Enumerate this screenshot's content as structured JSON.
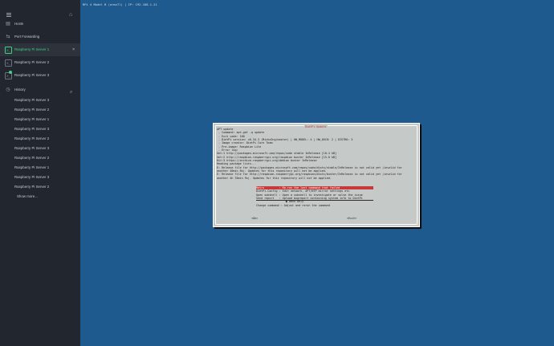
{
  "sidebar": {
    "nav": [
      {
        "label": "Hosts",
        "icon": "hosts-icon"
      },
      {
        "label": "Port Forwarding",
        "icon": "port-forwarding-icon"
      }
    ],
    "servers": [
      {
        "label": "Raspberry Pi Server 1",
        "active": true,
        "close": "×"
      },
      {
        "label": "Raspberry Pi Server 2",
        "active": false
      },
      {
        "label": "Raspberry Pi Server 3",
        "active": false
      }
    ],
    "history": {
      "label": "History",
      "items": [
        "Raspberry Pi Server 3",
        "Raspberry Pi Server 2",
        "Raspberry Pi Server 1",
        "Raspberry Pi Server 3",
        "Raspberry Pi Server 2",
        "Raspberry Pi Server 3",
        "Raspberry Pi Server 2",
        "Raspberry Pi Server 1",
        "Raspberry Pi Server 3",
        "Raspberry Pi Server 2"
      ],
      "show_more": "Show more..."
    }
  },
  "terminal": {
    "status_line": "RPi 4 Model B (armv7l) | IP: 192.168.1.21",
    "dialog": {
      "title": "DietPi-Update",
      "log_lines": [
        "APT update",
        " - Command: apt-get -q update",
        " - Exit code: 100",
        " - DietPi version: v6.34.3 (MichaIng/master) | HW_MODEL: 4 | HW_ARCH: 2 | DISTRO: 5",
        " - Image creator: DietPi Core Team",
        " - Pre-image: Raspbian Lite",
        " - Error log:",
        "Get:1 http://packages.microsoft.com/repos/code stable InRelease [10.4 kB]",
        "Get:2 http://raspbian.raspberrypi.org/raspbian buster InRelease [15.0 kB]",
        "Hit:3 https://archive.raspberrypi.org/debian buster InRelease",
        "Reading package lists...",
        "E: Release file for http://packages.microsoft.com/repos/code/dists/stable/InRelease is not valid yet (invalid for",
        "another 40min 8s). Updates for this repository will not be applied.",
        "E: Release file for http://raspbian.raspberrypi.org/raspbian/dists/buster/InRelease is not valid yet (invalid for",
        "another 4h 33min 9s). Updates for this repository will not be applied."
      ],
      "menu": [
        {
          "key": "Retry",
          "desc": ": Re-run the last command that failed",
          "selected": true
        },
        {
          "key": "DietPi-Config",
          "desc": ": Edit network, APT/NTP mirror settings etc"
        },
        {
          "key": "Open subshell",
          "desc": ": Open a subshell to investigate or solve the issue"
        },
        {
          "key": "Send report",
          "desc": ": Upload bugreport containing system info to DietPi"
        },
        {
          "key": "",
          "desc": "● Devs only"
        },
        {
          "key": "Change command",
          "desc": ": Adjust and rerun the command"
        }
      ],
      "ok_button": "<Ok>",
      "exit_button": "<Exit>"
    }
  },
  "colors": {
    "terminal_bg": "#1f5a8e",
    "sidebar_bg": "#22262e",
    "active_green": "#3fd08a",
    "dialog_bg": "#c5c9c7",
    "selection_red": "#c83a3a"
  }
}
